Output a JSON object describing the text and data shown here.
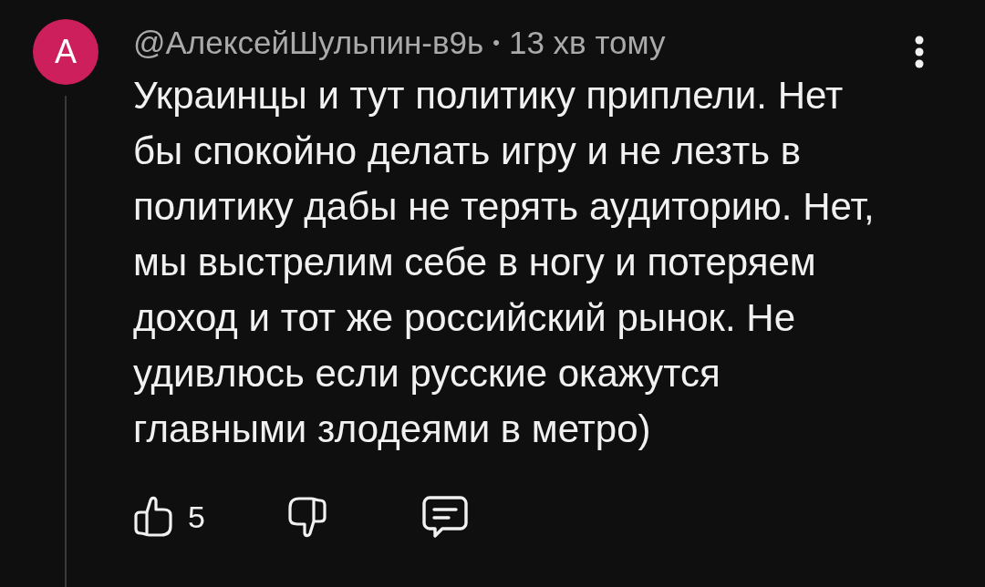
{
  "comment": {
    "avatar_letter": "А",
    "author": "@АлексейШульпин-в9ь",
    "separator": "•",
    "time": "13 хв тому",
    "text": "Украинцы и тут политику приплели. Нет\nбы спокойно делать игру и не лезть в\nполитику дабы не терять аудиторию. Нет,\nмы выстрелим себе в ногу и потеряем\nдоход и тот же российский рынок. Не\nудивлюсь если русские окажутся\nглавными злодеями в метро)",
    "like_count": "5"
  }
}
